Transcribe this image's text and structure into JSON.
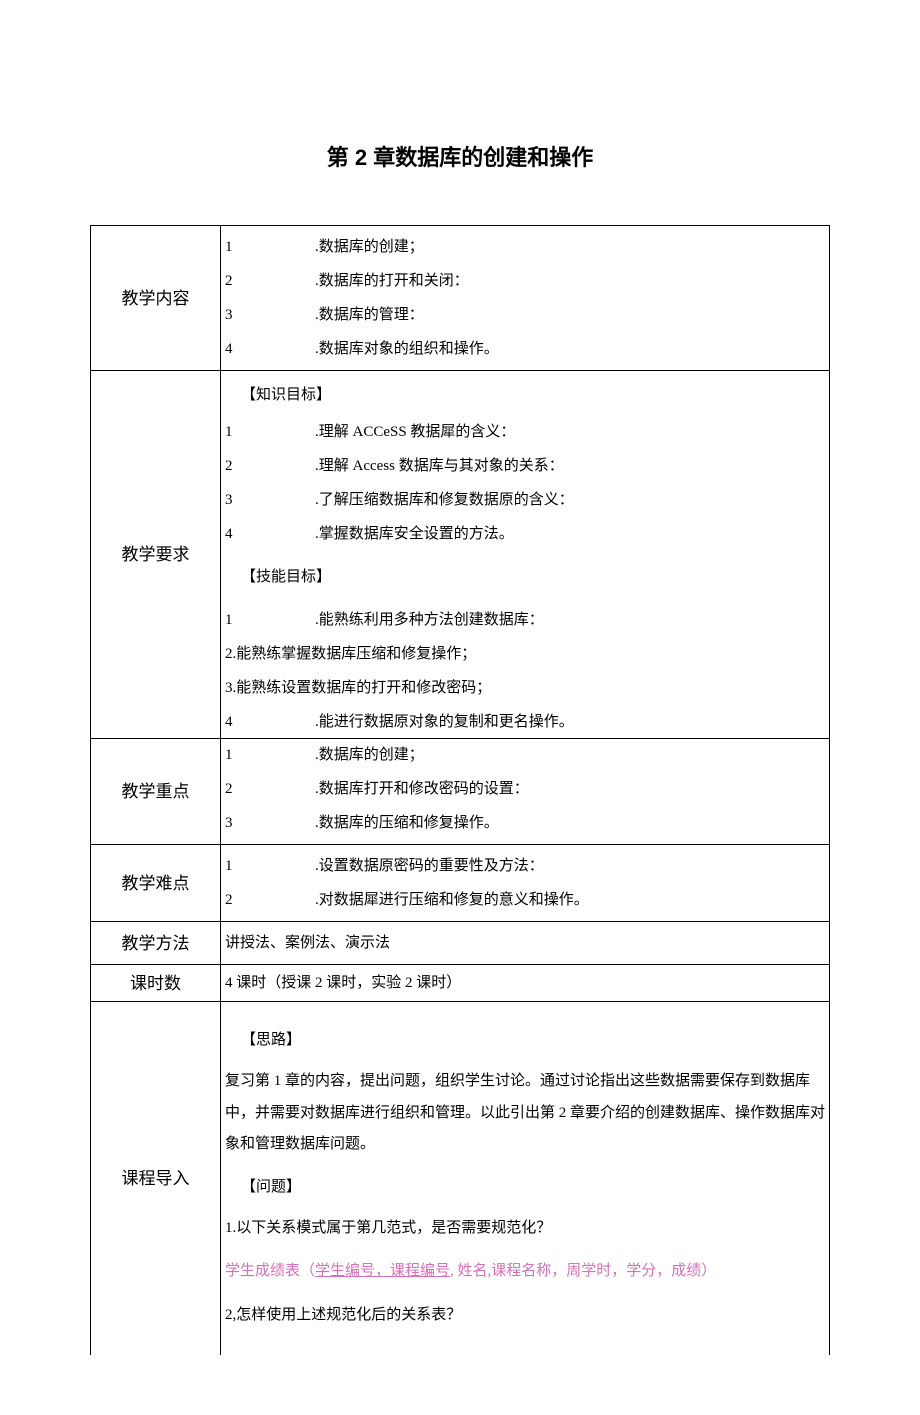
{
  "title": "第 2 章数据库的创建和操作",
  "rows": {
    "r1_label": "教学内容",
    "r1_items": [
      {
        "idx": "1",
        "txt": ".数据库的创建；"
      },
      {
        "idx": "2",
        "txt": ".数据库的打开和关闭："
      },
      {
        "idx": "3",
        "txt": ".数据库的管理："
      },
      {
        "idx": "4",
        "txt": ".数据库对象的组织和操作。"
      }
    ],
    "r2_label": "教学要求",
    "r2_h1": "【知识目标】",
    "r2_a": [
      {
        "idx": "1",
        "txt": ".理解 ACCeSS 教据犀的含义："
      },
      {
        "idx": "2",
        "txt": ".理解 Access 数据库与其对象的关系："
      },
      {
        "idx": "3",
        "txt": ".了解压缩数据库和修复数据原的含义："
      },
      {
        "idx": "4",
        "txt": ".掌握数据库安全设置的方法。"
      }
    ],
    "r2_h2": "【技能目标】",
    "r2_b1": {
      "idx": "1",
      "txt": ".能熟练利用多种方法创建数据库："
    },
    "r2_b2": "2.能熟练掌握数据库压缩和修复操作；",
    "r2_b3": "3.能熟练设置数据库的打开和修改密码；",
    "r2_b4": {
      "idx": "4",
      "txt": ".能进行数据原对象的复制和更名操作。"
    },
    "r3_label": "教学重点",
    "r3_items": [
      {
        "idx": "1",
        "txt": ".数据库的创建；"
      },
      {
        "idx": "2",
        "txt": ".数据库打开和修改密码的设置："
      },
      {
        "idx": "3",
        "txt": ".数据库的压缩和修复操作。"
      }
    ],
    "r4_label": "教学难点",
    "r4_items": [
      {
        "idx": "1",
        "txt": ".设置数据原密码的重要性及方法："
      },
      {
        "idx": "2",
        "txt": ".对数据犀进行压缩和修复的意义和操作。"
      }
    ],
    "r5_label": "教学方法",
    "r5_text": "讲授法、案例法、演示法",
    "r6_label": "课时数",
    "r6_text": "4 课时（授课 2 课时，实验 2 课时）",
    "r7_label": "课程导入",
    "r7_h1": "【思路】",
    "r7_p1": "复习第 1 章的内容，提出问题，组织学生讨论。通过讨论指出这些数据需要保存到数据库中，并需要对数据库进行组织和管理。以此引出第 2 章要介绍的创建数据库、操作数据库对象和管理数据库问题。",
    "r7_h2": "【问题】",
    "r7_q1": "1.以下关系模式属于第几范式，是否需要规范化？",
    "r7_q2a": "学生成绩表（",
    "r7_q2b": "学生编号，课程编号",
    "r7_q2c": ", 姓名,课程名称，周学时，学分，成绩）",
    "r7_q3": "2,怎样使用上述规范化后的关系表？"
  }
}
